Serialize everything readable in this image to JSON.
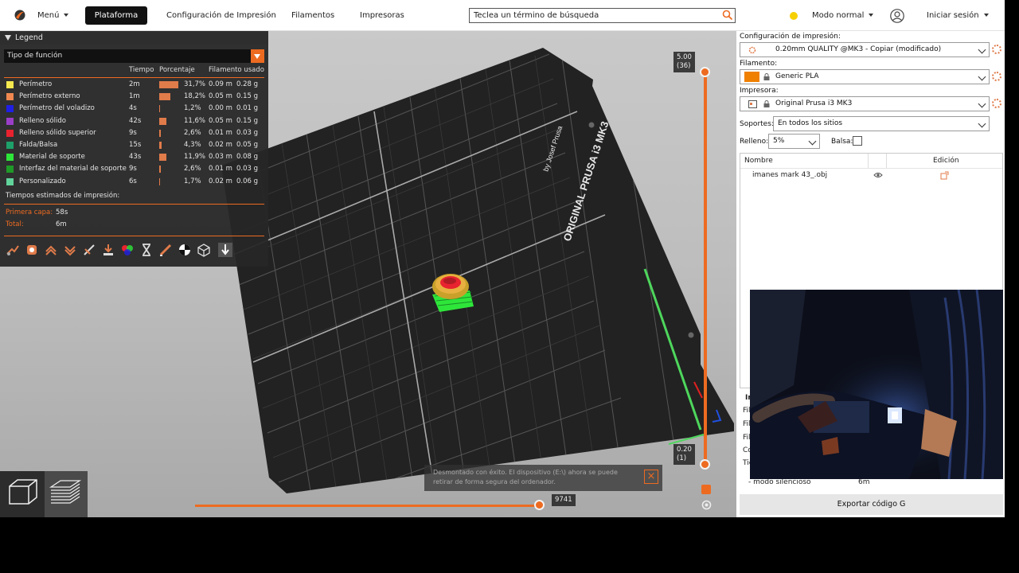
{
  "topbar": {
    "menu_label": "Menú",
    "tabs": [
      {
        "label": "Plataforma",
        "active": true
      },
      {
        "label": "Configuración de Impresión",
        "active": false
      },
      {
        "label": "Filamentos",
        "active": false
      },
      {
        "label": "Impresoras",
        "active": false
      }
    ],
    "search_placeholder": "Teclea un término de búsqueda",
    "mode_label": "Modo normal",
    "login_label": "Iniciar sesión"
  },
  "legend": {
    "title": "Legend",
    "feature_type": "Tipo de función",
    "headers": {
      "time": "Tiempo",
      "percent": "Porcentaje",
      "filament": "Filamento usado"
    },
    "rows": [
      {
        "name": "Perímetro",
        "color": "#f5e94f",
        "time": "2m",
        "percent": "31,7%",
        "pct": 31.7,
        "m": "0.09 m",
        "g": "0.28 g"
      },
      {
        "name": "Perímetro externo",
        "color": "#f08850",
        "time": "1m",
        "percent": "18,2%",
        "pct": 18.2,
        "m": "0.05 m",
        "g": "0.15 g"
      },
      {
        "name": "Perímetro del voladizo",
        "color": "#1f1fe6",
        "time": "4s",
        "percent": "1,2%",
        "pct": 1.2,
        "m": "0.00 m",
        "g": "0.01 g"
      },
      {
        "name": "Relleno sólido",
        "color": "#9a3ec8",
        "time": "42s",
        "percent": "11,6%",
        "pct": 11.6,
        "m": "0.05 m",
        "g": "0.15 g"
      },
      {
        "name": "Relleno sólido superior",
        "color": "#e8232f",
        "time": "9s",
        "percent": "2,6%",
        "pct": 2.6,
        "m": "0.01 m",
        "g": "0.03 g"
      },
      {
        "name": "Falda/Balsa",
        "color": "#1ea06a",
        "time": "15s",
        "percent": "4,3%",
        "pct": 4.3,
        "m": "0.02 m",
        "g": "0.05 g"
      },
      {
        "name": "Material de soporte",
        "color": "#2ee63a",
        "time": "43s",
        "percent": "11,9%",
        "pct": 11.9,
        "m": "0.03 m",
        "g": "0.08 g"
      },
      {
        "name": "Interfaz del material de soporte",
        "color": "#1f9a28",
        "time": "9s",
        "percent": "2,6%",
        "pct": 2.6,
        "m": "0.01 m",
        "g": "0.03 g"
      },
      {
        "name": "Personalizado",
        "color": "#62d39b",
        "time": "6s",
        "percent": "1,7%",
        "pct": 1.7,
        "m": "0.02 m",
        "g": "0.06 g"
      }
    ],
    "estimates_title": "Tiempos estimados de impresión:",
    "first_layer_label": "Primera capa:",
    "first_layer_value": "58s",
    "total_label": "Total:",
    "total_value": "6m"
  },
  "bed": {
    "brand_line1": "ORIGINAL PRUSA i3 MK3",
    "brand_line2": "by Josef Prusa"
  },
  "slider": {
    "top_value": "5.00",
    "top_layer": "(36)",
    "bottom_value": "0.20",
    "bottom_layer": "(1)",
    "horizontal_value": "9741"
  },
  "notification": {
    "text_line1": "Desmontado con éxito. El dispositivo (E:\\) ahora se puede",
    "text_line2": "retirar de forma segura del ordenador."
  },
  "rpanel": {
    "print_config_label": "Configuración de impresión:",
    "print_config_value": "0.20mm QUALITY @MK3 - Copiar (modificado)",
    "filament_label": "Filamento:",
    "filament_value": "Generic PLA",
    "filament_color": "#f08000",
    "printer_label": "Impresora:",
    "printer_value": "Original Prusa i3 MK3",
    "supports_label": "Soportes:",
    "supports_value": "En todos los sitios",
    "infill_label": "Relleno:",
    "infill_value": "5%",
    "raft_label": "Balsa:",
    "table_name_header": "Nombre",
    "table_edit_header": "Edición",
    "object_name": "imanes mark 43_.obj",
    "info_partial": [
      "In",
      "Fil",
      "Fil",
      "Fil",
      "Co",
      "Tie"
    ],
    "silent_mode_label": "- modo silencioso",
    "silent_mode_value": "6m",
    "export_label": "Exportar código G"
  }
}
